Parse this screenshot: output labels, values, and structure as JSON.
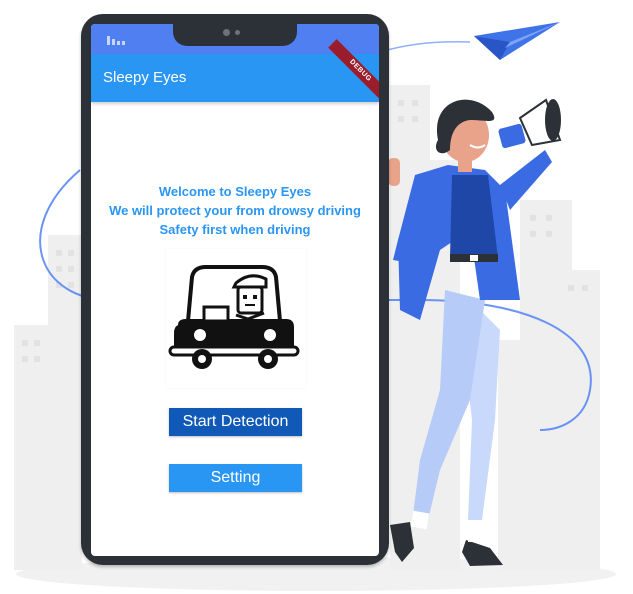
{
  "app": {
    "title": "Sleepy Eyes",
    "debug_banner": "DEBUG"
  },
  "welcome": {
    "line1": "Welcome to Sleepy Eyes",
    "line2": "We will protect your from drowsy driving",
    "line3": "Safety first when driving"
  },
  "buttons": {
    "start_label": "Start Detection",
    "setting_label": "Setting"
  },
  "colors": {
    "app_bar": "#2a96f3",
    "status_bar": "#4f7ff0",
    "start_button": "#1159b6",
    "setting_button": "#2a96f3",
    "text_accent": "#2a96f3"
  },
  "icons": {
    "illustration": "driver-in-car-icon",
    "decoration": "paper-plane-icon"
  }
}
